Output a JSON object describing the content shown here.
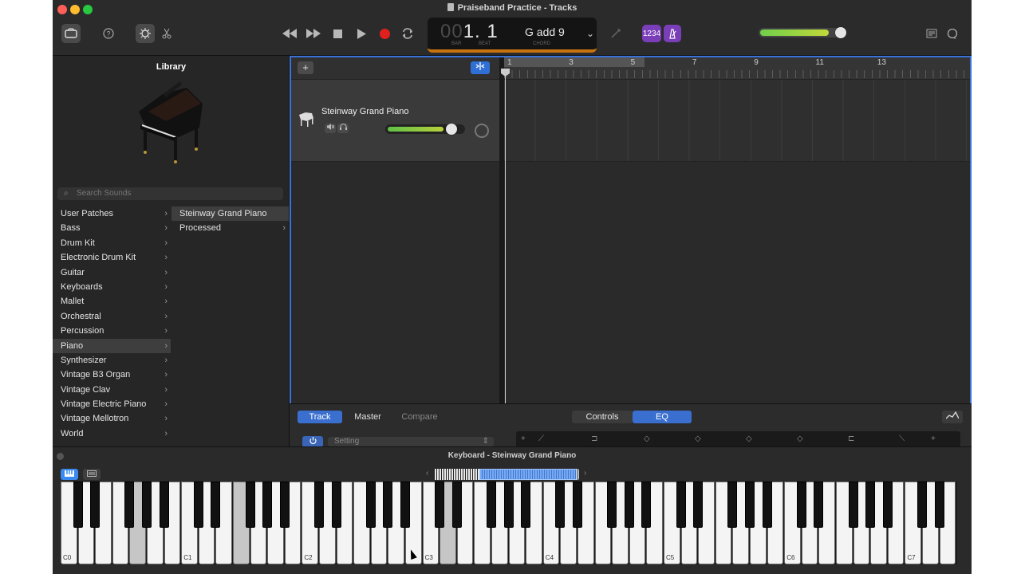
{
  "window": {
    "title": "Praiseband Practice - Tracks"
  },
  "toolbar": {
    "library_icon": "library-icon",
    "help_icon": "help-icon",
    "smart_controls_icon": "smart-controls-icon",
    "editors_icon": "scissors-icon",
    "rewind_icon": "rewind-icon",
    "forward_icon": "fast-forward-icon",
    "stop_icon": "stop-icon",
    "play_icon": "play-icon",
    "record_icon": "record-icon",
    "cycle_icon": "cycle-icon",
    "tuner_icon": "tuner-icon",
    "count_in_label": "1234",
    "metronome_icon": "metronome-icon",
    "notepad_icon": "notepad-icon",
    "loops_icon": "loops-icon",
    "master_volume_fraction": 0.8,
    "colors": {
      "record": "#e0201c",
      "lcd_accent": "#c8730e",
      "purple": "#7a3eb8"
    }
  },
  "lcd": {
    "bar_dim": "00",
    "position": "1. 1",
    "bar_label": "BAR",
    "beat_label": "BEAT",
    "chord_root": "G",
    "chord_quality": "add 9",
    "chord_label": "CHORD"
  },
  "library": {
    "title": "Library",
    "search_placeholder": "Search Sounds",
    "categories": [
      "User Patches",
      "Bass",
      "Drum Kit",
      "Electronic Drum Kit",
      "Guitar",
      "Keyboards",
      "Mallet",
      "Orchestral",
      "Percussion",
      "Piano",
      "Synthesizer",
      "Vintage B3 Organ",
      "Vintage Clav",
      "Vintage Electric Piano",
      "Vintage Mellotron",
      "World"
    ],
    "selected_category": "Piano",
    "patches": [
      "Steinway Grand Piano",
      "Processed"
    ]
  },
  "tracks": {
    "add_label": "+",
    "track_name": "Steinway Grand Piano",
    "mute_icon": "mute-icon",
    "headphones_icon": "solo-headphones-icon",
    "track_volume_fraction": 0.7,
    "ruler_numbers": [
      "1",
      "3",
      "5",
      "7",
      "9",
      "11",
      "13"
    ]
  },
  "smart_controls": {
    "tabs": [
      "Track",
      "Master",
      "Compare"
    ],
    "view_tabs": [
      "Controls",
      "EQ"
    ],
    "setting_placeholder": "Setting"
  },
  "keyboard": {
    "title": "Keyboard - Steinway Grand Piano",
    "octave_labels": [
      "C0",
      "C1",
      "C2",
      "C3",
      "C4",
      "C5",
      "C6",
      "C7"
    ]
  }
}
